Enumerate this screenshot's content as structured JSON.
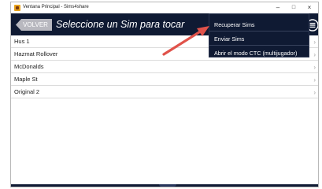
{
  "window": {
    "title": "Ventana Principal - Sims4share",
    "controls": {
      "minimize": "–",
      "maximize": "□",
      "close": "×"
    }
  },
  "header": {
    "back_label": "VOLVER",
    "title": "Seleccione un Sim para tocar",
    "menu_icon": "hamburger-circle-icon"
  },
  "list": {
    "items": [
      {
        "label": "Hus 1"
      },
      {
        "label": "Hazmat Rollover"
      },
      {
        "label": "McDonalds"
      },
      {
        "label": "Maple St"
      },
      {
        "label": "Original 2"
      }
    ],
    "chevron": "›"
  },
  "menu": {
    "items": [
      {
        "label": "Recuperar Sims"
      },
      {
        "label": "Enviar Sims"
      },
      {
        "label": "Abrir el modo CTC (multijugador)"
      }
    ]
  },
  "colors": {
    "header_bg": "#0f1a33",
    "back_button_bg": "#b8b8bf",
    "arrow": "#e0524a"
  }
}
